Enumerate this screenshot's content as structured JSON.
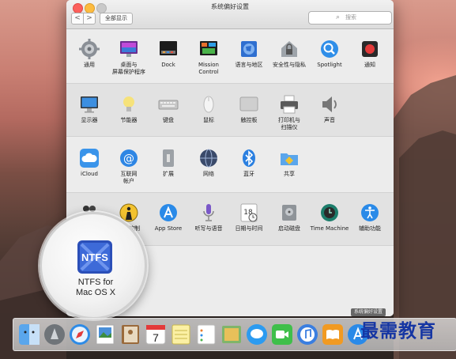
{
  "window": {
    "title": "系统偏好设置",
    "nav_back": "<",
    "nav_forward": ">",
    "show_all": "全部显示",
    "search_placeholder": "搜索"
  },
  "rows": [
    [
      {
        "label": "通用",
        "icon": "general-icon"
      },
      {
        "label": "桌面与\n屏幕保护程序",
        "icon": "desktop-screensaver-icon"
      },
      {
        "label": "Dock",
        "icon": "dock-icon"
      },
      {
        "label": "Mission\nControl",
        "icon": "mission-control-icon"
      },
      {
        "label": "语言与地区",
        "icon": "language-region-icon"
      },
      {
        "label": "安全性与隐私",
        "icon": "security-privacy-icon"
      },
      {
        "label": "Spotlight",
        "icon": "spotlight-icon"
      },
      {
        "label": "通知",
        "icon": "notifications-icon"
      }
    ],
    [
      {
        "label": "显示器",
        "icon": "displays-icon"
      },
      {
        "label": "节能器",
        "icon": "energy-saver-icon"
      },
      {
        "label": "键盘",
        "icon": "keyboard-icon"
      },
      {
        "label": "鼠标",
        "icon": "mouse-icon"
      },
      {
        "label": "触控板",
        "icon": "trackpad-icon"
      },
      {
        "label": "打印机与\n扫描仪",
        "icon": "printers-scanners-icon"
      },
      {
        "label": "声音",
        "icon": "sound-icon"
      }
    ],
    [
      {
        "label": "iCloud",
        "icon": "icloud-icon"
      },
      {
        "label": "互联网\n帐户",
        "icon": "internet-accounts-icon"
      },
      {
        "label": "扩展",
        "icon": "extensions-icon"
      },
      {
        "label": "网络",
        "icon": "network-icon"
      },
      {
        "label": "蓝牙",
        "icon": "bluetooth-icon"
      },
      {
        "label": "共享",
        "icon": "sharing-icon"
      }
    ],
    [
      {
        "label": "",
        "icon": "users-groups-icon"
      },
      {
        "label": "家长控制",
        "icon": "parental-controls-icon"
      },
      {
        "label": "App Store",
        "icon": "app-store-icon"
      },
      {
        "label": "听写与语音",
        "icon": "dictation-speech-icon"
      },
      {
        "label": "日期与时间",
        "icon": "date-time-icon"
      },
      {
        "label": "启动磁盘",
        "icon": "startup-disk-icon"
      },
      {
        "label": "Time Machine",
        "icon": "time-machine-icon"
      },
      {
        "label": "辅助功能",
        "icon": "accessibility-icon"
      }
    ]
  ],
  "magnified": {
    "icon_text": "NTFS",
    "label": "NTFS for\nMac OS X"
  },
  "dock_tooltip": "系统偏好设置",
  "dock_items": [
    "finder-icon",
    "launchpad-icon",
    "safari-icon",
    "preview-icon",
    "contacts-icon",
    "calendar-icon",
    "notes-icon",
    "reminders-icon",
    "photo-booth-icon",
    "messages-icon",
    "facetime-icon",
    "itunes-icon",
    "ibooks-icon",
    "app-store-icon"
  ],
  "calendar_day": "7",
  "watermark": "最需教育",
  "colors": {
    "accent_blue": "#1a7ee6",
    "watermark_blue": "#1636a3"
  }
}
